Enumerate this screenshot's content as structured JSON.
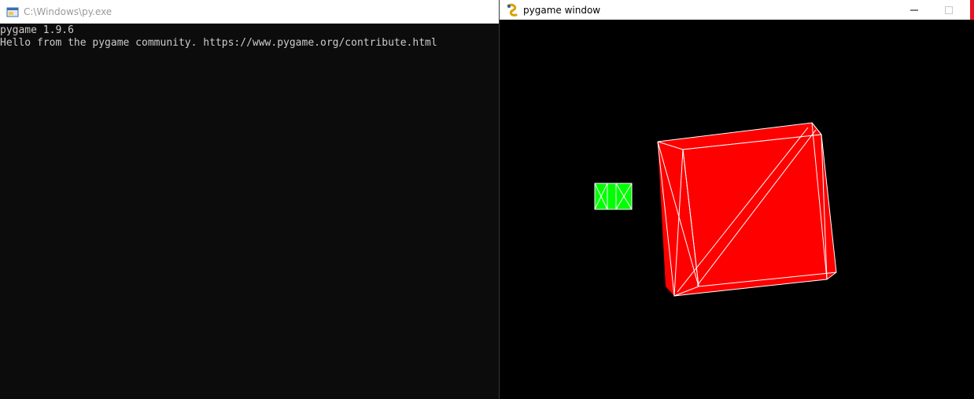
{
  "console": {
    "title": "C:\\Windows\\py.exe",
    "lines": [
      "pygame 1.9.6",
      "Hello from the pygame community. https://www.pygame.org/contribute.html"
    ]
  },
  "pygame": {
    "title": "pygame window",
    "colors": {
      "background": "#000000",
      "red_cube": "#ff0000",
      "green_cube": "#00ff00",
      "wireframe": "#ffffff"
    }
  },
  "icons": {
    "console_app": "console-app-icon",
    "pygame_app": "pygame-snake-icon",
    "minimize": "minimize-icon",
    "maximize": "maximize-icon",
    "close": "close-icon"
  }
}
